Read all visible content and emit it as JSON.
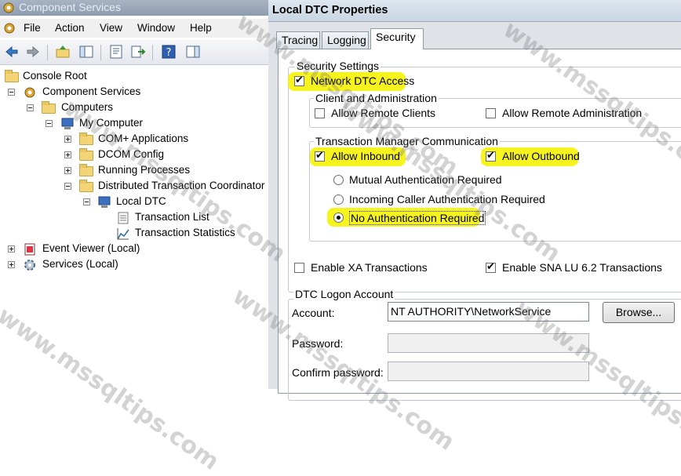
{
  "mmc": {
    "title": "Component Services",
    "menu": [
      "File",
      "Action",
      "View",
      "Window",
      "Help"
    ],
    "tree": [
      {
        "label": "Console Root",
        "icon": "folder-icon"
      },
      {
        "label": "Component Services",
        "icon": "component-services-icon"
      },
      {
        "label": "Computers",
        "icon": "folder-icon"
      },
      {
        "label": "My Computer",
        "icon": "computer-icon"
      },
      {
        "label": "COM+ Applications",
        "icon": "folder-icon"
      },
      {
        "label": "DCOM Config",
        "icon": "folder-icon"
      },
      {
        "label": "Running Processes",
        "icon": "folder-icon"
      },
      {
        "label": "Distributed Transaction Coordinator",
        "icon": "folder-icon"
      },
      {
        "label": "Local DTC",
        "icon": "computer-icon"
      },
      {
        "label": "Transaction List",
        "icon": "list-icon"
      },
      {
        "label": "Transaction Statistics",
        "icon": "chart-icon"
      },
      {
        "label": "Event Viewer (Local)",
        "icon": "event-viewer-icon"
      },
      {
        "label": "Services (Local)",
        "icon": "gear-icon"
      }
    ]
  },
  "dialog": {
    "title": "Local DTC Properties",
    "tabs": [
      "Tracing",
      "Logging",
      "Security"
    ],
    "security_settings": {
      "title": "Security Settings",
      "network_dtc_access": "Network DTC Access",
      "client_admin": {
        "title": "Client and Administration",
        "allow_remote_clients": "Allow Remote Clients",
        "allow_remote_admin": "Allow Remote Administration"
      },
      "tm_comm": {
        "title": "Transaction Manager Communication",
        "allow_inbound": "Allow Inbound",
        "allow_outbound": "Allow Outbound",
        "mutual_auth": "Mutual Authentication Required",
        "incoming_caller_auth": "Incoming Caller Authentication Required",
        "no_auth": "No Authentication Required"
      },
      "enable_xa": "Enable XA Transactions",
      "enable_sna": "Enable SNA LU 6.2 Transactions"
    },
    "logon": {
      "title": "DTC Logon Account",
      "account_label": "Account:",
      "account_value": "NT AUTHORITY\\NetworkService",
      "browse_label": "Browse...",
      "password_label": "Password:",
      "confirm_label": "Confirm password:"
    }
  },
  "watermark": "www.mssqltips.com",
  "colors": {
    "highlight": "#f5f213"
  }
}
